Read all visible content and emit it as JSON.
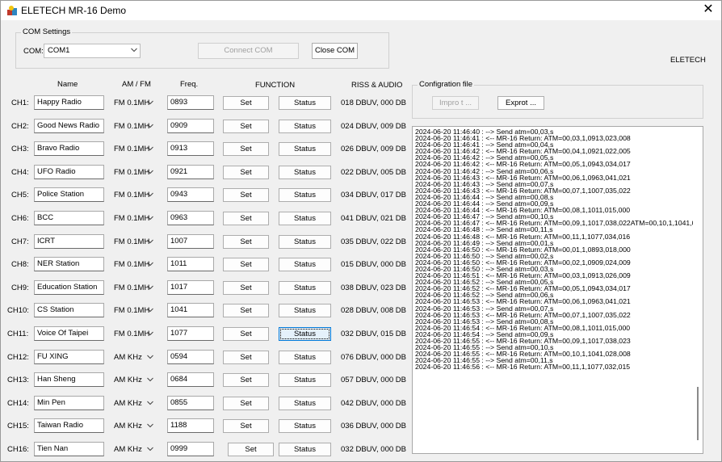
{
  "window": {
    "title": "ELETECH MR-16 Demo",
    "close_glyph": "✕"
  },
  "com_settings": {
    "group_label": "COM Settings",
    "com_label": "COM:",
    "port_value": "COM1",
    "connect_label": "Connect COM",
    "close_label": "Close COM"
  },
  "brand": "ELETECH",
  "headers": {
    "name": "Name",
    "band": "AM / FM",
    "freq": "Freq.",
    "function": "FUNCTION",
    "riss": "RISS & AUDIO"
  },
  "config": {
    "group_label": "Configration file",
    "import_label": "Impro t ...",
    "export_label": "Exprot ..."
  },
  "channels": [
    {
      "label": "CH1:",
      "name": "Happy Radio",
      "band": "FM 0.1MH",
      "freq": "0893",
      "set": "Set",
      "status": "Status",
      "riss": "018 DBUV, 000 DB"
    },
    {
      "label": "CH2:",
      "name": "Good News Radio",
      "band": "FM 0.1MH",
      "freq": "0909",
      "set": "Set",
      "status": "Status",
      "riss": "024 DBUV, 009 DB"
    },
    {
      "label": "CH3:",
      "name": "Bravo Radio",
      "band": "FM 0.1MH",
      "freq": "0913",
      "set": "Set",
      "status": "Status",
      "riss": "026 DBUV, 009 DB"
    },
    {
      "label": "CH4:",
      "name": "UFO Radio",
      "band": "FM 0.1MH",
      "freq": "0921",
      "set": "Set",
      "status": "Status",
      "riss": "022 DBUV, 005 DB"
    },
    {
      "label": "CH5:",
      "name": "Police Station",
      "band": "FM 0.1MH",
      "freq": "0943",
      "set": "Set",
      "status": "Status",
      "riss": "034 DBUV, 017 DB"
    },
    {
      "label": "CH6:",
      "name": "BCC",
      "band": "FM 0.1MH",
      "freq": "0963",
      "set": "Set",
      "status": "Status",
      "riss": "041 DBUV, 021 DB"
    },
    {
      "label": "CH7:",
      "name": "ICRT",
      "band": "FM 0.1MH",
      "freq": "1007",
      "set": "Set",
      "status": "Status",
      "riss": "035 DBUV, 022 DB"
    },
    {
      "label": "CH8:",
      "name": "NER Station",
      "band": "FM 0.1MH",
      "freq": "1011",
      "set": "Set",
      "status": "Status",
      "riss": "015 DBUV, 000 DB"
    },
    {
      "label": "CH9:",
      "name": "Education Station",
      "band": "FM 0.1MH",
      "freq": "1017",
      "set": "Set",
      "status": "Status",
      "riss": "038 DBUV, 023 DB"
    },
    {
      "label": "CH10:",
      "name": "CS Station",
      "band": "FM 0.1MH",
      "freq": "1041",
      "set": "Set",
      "status": "Status",
      "riss": "028 DBUV, 008 DB"
    },
    {
      "label": "CH11:",
      "name": "Voice Of Taipei",
      "band": "FM 0.1MH",
      "freq": "1077",
      "set": "Set",
      "status": "Status",
      "riss": "032 DBUV, 015 DB"
    },
    {
      "label": "CH12:",
      "name": "FU XING",
      "band": "AM KHz",
      "freq": "0594",
      "set": "Set",
      "status": "Status",
      "riss": "076 DBUV, 000 DB"
    },
    {
      "label": "CH13:",
      "name": "Han Sheng",
      "band": "AM KHz",
      "freq": "0684",
      "set": "Set",
      "status": "Status",
      "riss": "057 DBUV, 000 DB"
    },
    {
      "label": "CH14:",
      "name": "Min Pen",
      "band": "AM KHz",
      "freq": "0855",
      "set": "Set",
      "status": "Status",
      "riss": "042 DBUV, 000 DB"
    },
    {
      "label": "CH15:",
      "name": "Taiwan Radio",
      "band": "AM KHz",
      "freq": "1188",
      "set": "Set",
      "status": "Status",
      "riss": "036 DBUV, 000 DB"
    },
    {
      "label": "CH16:",
      "name": "Tien Nan",
      "band": "AM KHz",
      "freq": "0999",
      "set": "Set",
      "status": "Status",
      "riss": "032 DBUV, 000 DB"
    }
  ],
  "log": [
    "2024-06-20 11:46:40 : --> Send atm=00,03,s",
    "2024-06-20 11:46:41 : <-- MR-16 Return: ATM=00,03,1,0913,023,008",
    "2024-06-20 11:46:41 : --> Send atm=00,04,s",
    "2024-06-20 11:46:42 : <-- MR-16 Return: ATM=00,04,1,0921,022,005",
    "2024-06-20 11:46:42 : --> Send atm=00,05,s",
    "2024-06-20 11:46:42 : <-- MR-16 Return: ATM=00,05,1,0943,034,017",
    "2024-06-20 11:46:42 : --> Send atm=00,06,s",
    "2024-06-20 11:46:43 : <-- MR-16 Return: ATM=00,06,1,0963,041,021",
    "2024-06-20 11:46:43 : --> Send atm=00,07,s",
    "2024-06-20 11:46:43 : <-- MR-16 Return: ATM=00,07,1,1007,035,022",
    "2024-06-20 11:46:44 : --> Send atm=00,08,s",
    "2024-06-20 11:46:44 : --> Send atm=00,09,s",
    "2024-06-20 11:46:44 : <-- MR-16 Return: ATM=00,08,1,1011,015,000",
    "2024-06-20 11:46:47 : --> Send atm=00,10,s",
    "2024-06-20 11:46:47 : <-- MR-16 Return: ATM=00,09,1,1017,038,022ATM=00,10,1,1041,0",
    "2024-06-20 11:46:48 : --> Send atm=00,11,s",
    "2024-06-20 11:46:48 : <-- MR-16 Return: ATM=00,11,1,1077,034,016",
    "2024-06-20 11:46:49 : --> Send atm=00,01,s",
    "2024-06-20 11:46:50 : <-- MR-16 Return: ATM=00,01,1,0893,018,000",
    "2024-06-20 11:46:50 : --> Send atm=00,02,s",
    "2024-06-20 11:46:50 : <-- MR-16 Return: ATM=00,02,1,0909,024,009",
    "2024-06-20 11:46:50 : --> Send atm=00,03,s",
    "2024-06-20 11:46:51 : <-- MR-16 Return: ATM=00,03,1,0913,026,009",
    "2024-06-20 11:46:52 : --> Send atm=00,05,s",
    "2024-06-20 11:46:52 : <-- MR-16 Return: ATM=00,05,1,0943,034,017",
    "2024-06-20 11:46:52 : --> Send atm=00,06,s",
    "2024-06-20 11:46:53 : <-- MR-16 Return: ATM=00,06,1,0963,041,021",
    "2024-06-20 11:46:53 : --> Send atm=00,07,s",
    "2024-06-20 11:46:53 : <-- MR-16 Return: ATM=00,07,1,1007,035,022",
    "2024-06-20 11:46:53 : --> Send atm=00,08,s",
    "2024-06-20 11:46:54 : <-- MR-16 Return: ATM=00,08,1,1011,015,000",
    "2024-06-20 11:46:54 : --> Send atm=00,09,s",
    "2024-06-20 11:46:55 : <-- MR-16 Return: ATM=00,09,1,1017,038,023",
    "2024-06-20 11:46:55 : --> Send atm=00,10,s",
    "2024-06-20 11:46:55 : <-- MR-16 Return: ATM=00,10,1,1041,028,008",
    "2024-06-20 11:46:55 : --> Send atm=00,11,s",
    "2024-06-20 11:46:56 : <-- MR-16 Return: ATM=00,11,1,1077,032,015"
  ]
}
